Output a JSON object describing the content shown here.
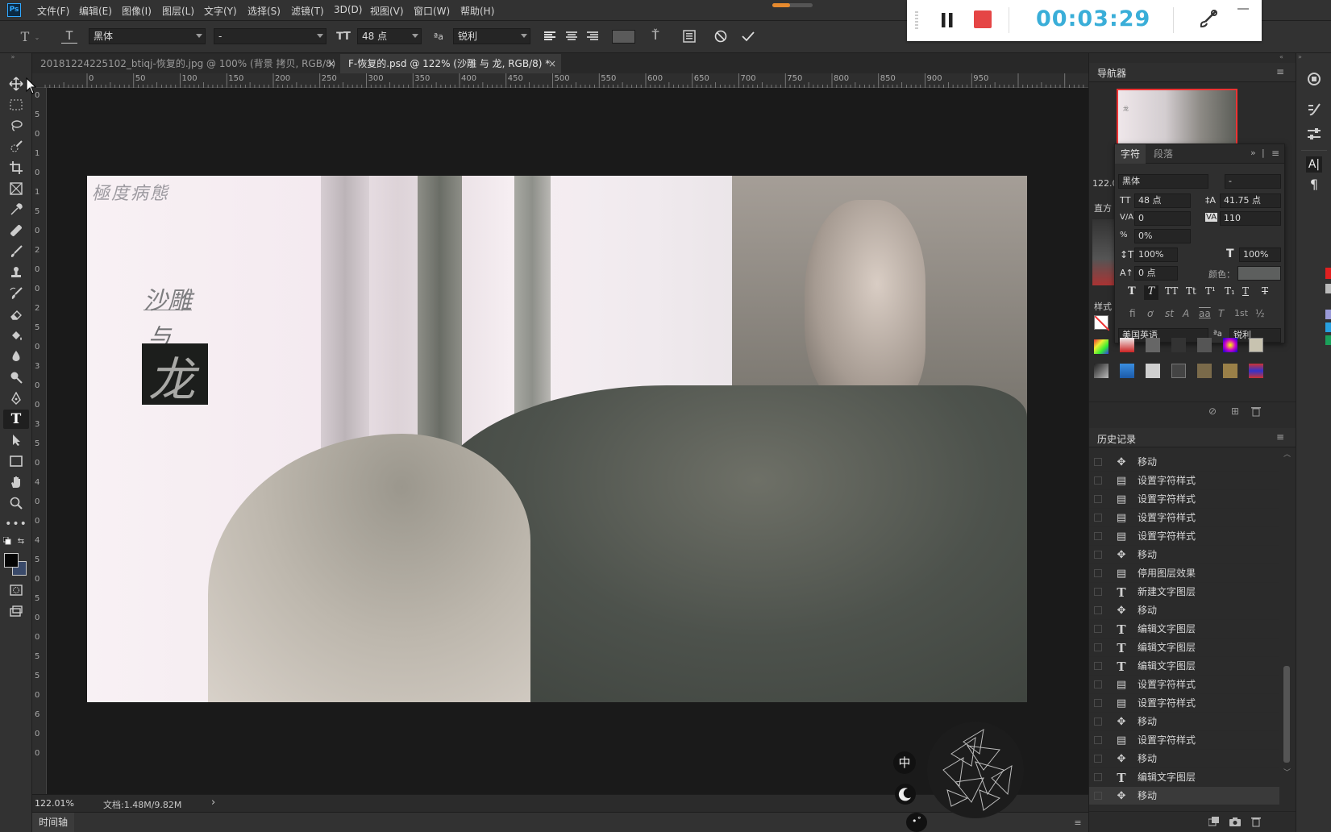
{
  "app_logo": "Ps",
  "menu": [
    "文件(F)",
    "编辑(E)",
    "图像(I)",
    "图层(L)",
    "文字(Y)",
    "选择(S)",
    "滤镜(T)",
    "3D(D)",
    "视图(V)",
    "窗口(W)",
    "帮助(H)"
  ],
  "options": {
    "font_family": "黑体",
    "font_style": "-",
    "font_size": "48 点",
    "antialias": "锐利"
  },
  "tabs": [
    {
      "label": "20181224225102_btiqj-恢复的.jpg @ 100% (背景 拷贝, RGB/8) *",
      "close": "×",
      "active": false
    },
    {
      "label": "F-恢复的.psd @ 122% (沙雕 与 龙, RGB/8) *",
      "close": "×",
      "active": true
    }
  ],
  "ruler_h": [
    "0",
    "50",
    "100",
    "150",
    "200",
    "250",
    "300",
    "350",
    "400",
    "450",
    "500",
    "550",
    "600",
    "650",
    "700",
    "750",
    "800",
    "850",
    "900",
    "950"
  ],
  "ruler_v": [
    "0",
    "5",
    "0",
    "1",
    "0",
    "1",
    "5",
    "0",
    "2",
    "0",
    "0",
    "2",
    "5",
    "0",
    "3",
    "0",
    "0",
    "3",
    "5",
    "0",
    "4",
    "0",
    "0",
    "4",
    "5",
    "0",
    "5",
    "0",
    "0",
    "5",
    "5",
    "0",
    "6",
    "0",
    "0"
  ],
  "canvas_text": {
    "watermark": "極度病態",
    "line1": "沙雕",
    "line2": "与",
    "line3": "龙"
  },
  "status": {
    "zoom": "122.01%",
    "doc": "文档:1.48M/9.82M",
    "arrow": "›"
  },
  "timeline_label": "时间轴",
  "recorder": {
    "time": "00:03:29"
  },
  "navigator": {
    "title": "导航器",
    "zoom": "122.0"
  },
  "side_labels": {
    "histogram": "直方",
    "styles": "样式"
  },
  "character": {
    "tab_active": "字符",
    "tab_other": "段落",
    "font_family": "黑体",
    "font_style": "-",
    "size": "48 点",
    "leading": "41.75 点",
    "kerning": "0",
    "tracking": "110",
    "scale_pct": "0%",
    "vscale": "100%",
    "hscale": "100%",
    "baseline": "0 点",
    "color_label": "颜色：",
    "language": "美国英语",
    "antialias": "锐利",
    "style_buttons": [
      "T",
      "T",
      "TT",
      "Tt",
      "T¹",
      "T₁",
      "T",
      "T"
    ],
    "ot_buttons": [
      "fi",
      "ơ",
      "st",
      "A",
      "aa",
      "T",
      "1st",
      "½"
    ]
  },
  "history": {
    "title": "历史记录",
    "items": [
      {
        "icon": "move",
        "label": "移动"
      },
      {
        "icon": "doc",
        "label": "设置字符样式"
      },
      {
        "icon": "doc",
        "label": "设置字符样式"
      },
      {
        "icon": "doc",
        "label": "设置字符样式"
      },
      {
        "icon": "doc",
        "label": "设置字符样式"
      },
      {
        "icon": "move",
        "label": "移动"
      },
      {
        "icon": "doc",
        "label": "停用图层效果"
      },
      {
        "icon": "type",
        "label": "新建文字图层"
      },
      {
        "icon": "move",
        "label": "移动"
      },
      {
        "icon": "type",
        "label": "编辑文字图层"
      },
      {
        "icon": "type",
        "label": "编辑文字图层"
      },
      {
        "icon": "type",
        "label": "编辑文字图层"
      },
      {
        "icon": "doc",
        "label": "设置字符样式"
      },
      {
        "icon": "doc",
        "label": "设置字符样式"
      },
      {
        "icon": "move",
        "label": "移动"
      },
      {
        "icon": "doc",
        "label": "设置字符样式"
      },
      {
        "icon": "move",
        "label": "移动"
      },
      {
        "icon": "type",
        "label": "编辑文字图层"
      },
      {
        "icon": "move",
        "label": "移动"
      }
    ]
  },
  "ime": {
    "lang": "中"
  },
  "colors": {
    "accent_blue": "#31a8ff",
    "record_red": "#e54545",
    "timer_blue": "#3aaed8"
  }
}
